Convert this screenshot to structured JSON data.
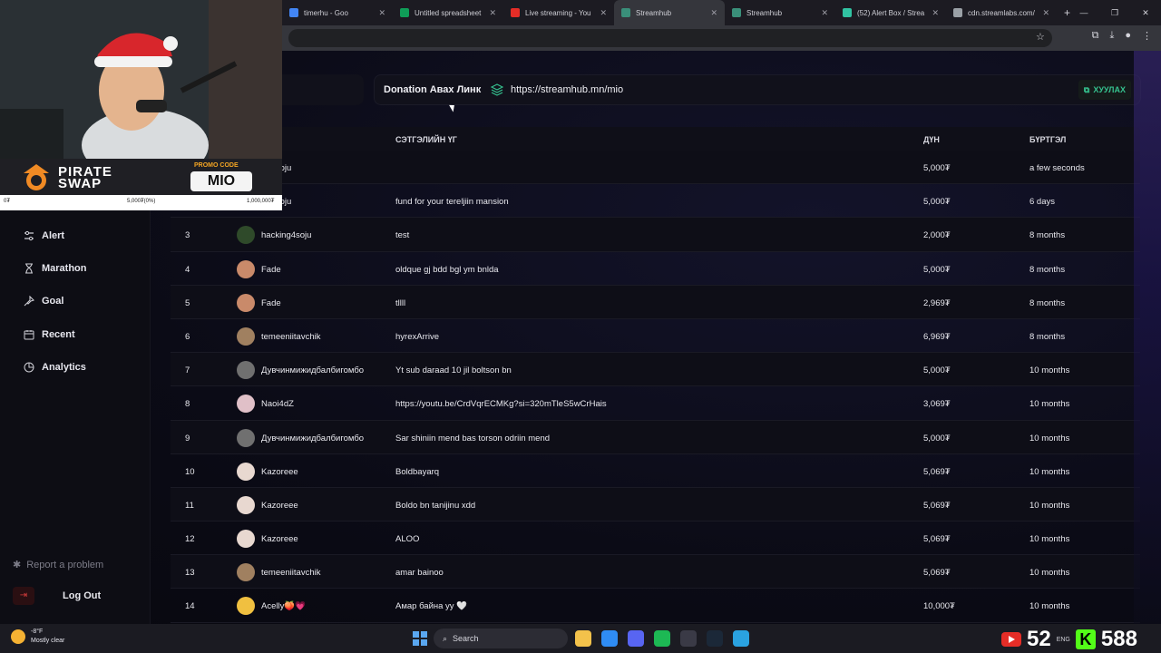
{
  "browser": {
    "tabs": [
      {
        "label": "timerhu - Goo",
        "color": "#4285f4"
      },
      {
        "label": "Untitled spreadsheet",
        "color": "#0f9d58"
      },
      {
        "label": "Live streaming - You",
        "color": "#e52d27"
      },
      {
        "label": "Streamhub",
        "color": "#3a8f7a"
      },
      {
        "label": "Streamhub",
        "color": "#3a8f7a"
      },
      {
        "label": "(52) Alert Box / Strea",
        "color": "#31c3a2"
      },
      {
        "label": "cdn.streamlabs.com/",
        "color": "#9aa0a6"
      }
    ],
    "active_tab": 3
  },
  "sidebar": {
    "items": [
      {
        "label": "Alert",
        "icon": "sliders-icon"
      },
      {
        "label": "Marathon",
        "icon": "hourglass-icon"
      },
      {
        "label": "Goal",
        "icon": "pin-icon"
      },
      {
        "label": "Recent",
        "icon": "calendar-icon"
      },
      {
        "label": "Analytics",
        "icon": "pie-chart-icon"
      }
    ],
    "report_label": "Report a problem",
    "logout_label": "Log Out"
  },
  "donation": {
    "label": "Donation Авах Линк",
    "url": "https://streamhub.mn/mio",
    "copy_label": "ХУУЛАХ"
  },
  "table": {
    "headers": {
      "message": "СЭТГЭЛИЙН ҮГ",
      "amount": "ДҮН",
      "registered": "БҮРТГЭЛ"
    },
    "rows": [
      {
        "num": "",
        "name": "ng4soju",
        "message": "",
        "amount": "5,000₮",
        "time": "a few seconds",
        "avatar": "#2c3a2c"
      },
      {
        "num": "",
        "name": "ng4soju",
        "message": "fund for your tereljiin mansion",
        "amount": "5,000₮",
        "time": "6 days",
        "avatar": "#2c3a2c"
      },
      {
        "num": "3",
        "name": "hacking4soju",
        "message": "test",
        "amount": "2,000₮",
        "time": "8 months",
        "avatar": "#2f4a2a"
      },
      {
        "num": "4",
        "name": "Fade",
        "message": "oldque gj bdd bgl ym bnlda",
        "amount": "5,000₮",
        "time": "8 months",
        "avatar": "#c98a6a"
      },
      {
        "num": "5",
        "name": "Fade",
        "message": "tllll",
        "amount": "2,969₮",
        "time": "8 months",
        "avatar": "#c98a6a"
      },
      {
        "num": "6",
        "name": "temeeniitavchik",
        "message": "hyrexArrive",
        "amount": "6,969₮",
        "time": "8 months",
        "avatar": "#a08060"
      },
      {
        "num": "7",
        "name": "Дувчинмижидбалбигомбо",
        "message": "Yt sub daraad 10 jil boltson bn",
        "amount": "5,000₮",
        "time": "10 months",
        "avatar": "#707070"
      },
      {
        "num": "8",
        "name": "Naoi4dZ",
        "message": "https://youtu.be/CrdVqrECMKg?si=320mTleS5wCrHais",
        "amount": "3,069₮",
        "time": "10 months",
        "avatar": "#e0c0c8"
      },
      {
        "num": "9",
        "name": "Дувчинмижидбалбигомбо",
        "message": "Sar shiniin mend bas torson odriin mend",
        "amount": "5,000₮",
        "time": "10 months",
        "avatar": "#707070"
      },
      {
        "num": "10",
        "name": "Kazoreee",
        "message": "Boldbayarq",
        "amount": "5,069₮",
        "time": "10 months",
        "avatar": "#e8d8d0"
      },
      {
        "num": "11",
        "name": "Kazoreee",
        "message": "Boldo bn tanijinu xdd",
        "amount": "5,069₮",
        "time": "10 months",
        "avatar": "#e8d8d0"
      },
      {
        "num": "12",
        "name": "Kazoreee",
        "message": "ALOO",
        "amount": "5,069₮",
        "time": "10 months",
        "avatar": "#e8d8d0"
      },
      {
        "num": "13",
        "name": "temeeniitavchik",
        "message": "amar bainoo",
        "amount": "5,069₮",
        "time": "10 months",
        "avatar": "#a08060"
      },
      {
        "num": "14",
        "name": "Acelly🍑💗",
        "message": "Амар байна уу 🤍",
        "amount": "10,000₮",
        "time": "10 months",
        "avatar": "#f0c040"
      }
    ]
  },
  "overlay": {
    "brand": "PIRATE\nSWAP",
    "promo_label": "PROMO CODE",
    "promo_code": "MIO",
    "progress_left": "0₮",
    "progress_mid": "5,000₮(0%)",
    "progress_right": "1,000,000₮"
  },
  "taskbar": {
    "temp": "-8°F",
    "weather": "Mostly clear",
    "search": "Search",
    "youtube_count": "52",
    "lang": "ENG",
    "kick_count": "588"
  }
}
